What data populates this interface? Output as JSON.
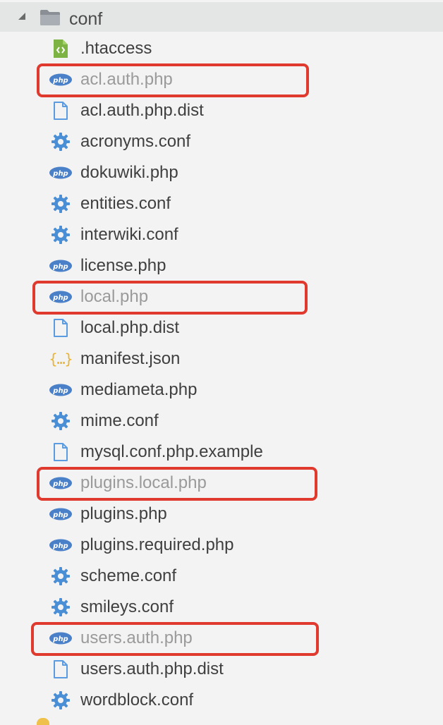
{
  "folder": {
    "name": "conf",
    "expanded": true
  },
  "files": [
    {
      "name": ".htaccess",
      "icon": "code-file-icon",
      "highlighted": false
    },
    {
      "name": "acl.auth.php",
      "icon": "php-icon",
      "highlighted": true
    },
    {
      "name": "acl.auth.php.dist",
      "icon": "file-icon",
      "highlighted": false
    },
    {
      "name": "acronyms.conf",
      "icon": "gear-icon",
      "highlighted": false
    },
    {
      "name": "dokuwiki.php",
      "icon": "php-icon",
      "highlighted": false
    },
    {
      "name": "entities.conf",
      "icon": "gear-icon",
      "highlighted": false
    },
    {
      "name": "interwiki.conf",
      "icon": "gear-icon",
      "highlighted": false
    },
    {
      "name": "license.php",
      "icon": "php-icon",
      "highlighted": false
    },
    {
      "name": "local.php",
      "icon": "php-icon",
      "highlighted": true
    },
    {
      "name": "local.php.dist",
      "icon": "file-icon",
      "highlighted": false
    },
    {
      "name": "manifest.json",
      "icon": "json-icon",
      "highlighted": false
    },
    {
      "name": "mediameta.php",
      "icon": "php-icon",
      "highlighted": false
    },
    {
      "name": "mime.conf",
      "icon": "gear-icon",
      "highlighted": false
    },
    {
      "name": "mysql.conf.php.example",
      "icon": "file-icon",
      "highlighted": false
    },
    {
      "name": "plugins.local.php",
      "icon": "php-icon",
      "highlighted": true
    },
    {
      "name": "plugins.php",
      "icon": "php-icon",
      "highlighted": false
    },
    {
      "name": "plugins.required.php",
      "icon": "php-icon",
      "highlighted": false
    },
    {
      "name": "scheme.conf",
      "icon": "gear-icon",
      "highlighted": false
    },
    {
      "name": "smileys.conf",
      "icon": "gear-icon",
      "highlighted": false
    },
    {
      "name": "users.auth.php",
      "icon": "php-icon",
      "highlighted": true
    },
    {
      "name": "users.auth.php.dist",
      "icon": "file-icon",
      "highlighted": false
    },
    {
      "name": "wordblock.conf",
      "icon": "gear-icon",
      "highlighted": false
    }
  ],
  "colors": {
    "highlight_border": "#e03a2f",
    "php_icon": "#4a80c8",
    "gear_icon": "#4a8fd6",
    "file_icon": "#5b9be0",
    "code_icon": "#7cb342",
    "json_icon": "#e7b43a",
    "folder_row_bg": "#e4e6e6"
  }
}
